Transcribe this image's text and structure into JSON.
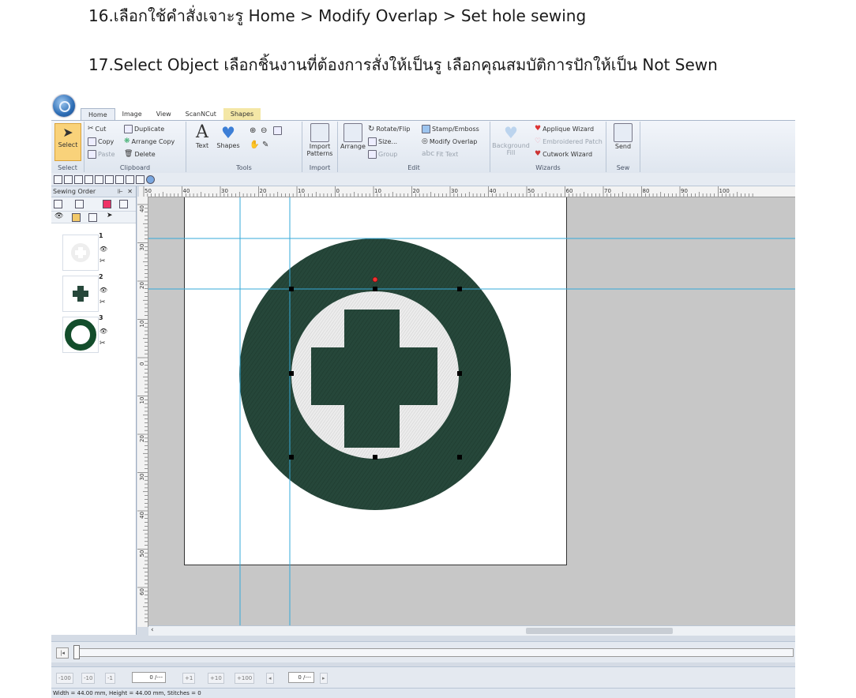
{
  "document": {
    "line16": "16.เลือกใช้คำสั่งเจาะรู  Home > Modify Overlap > Set hole sewing",
    "line17": "17.Select Object เลือกชิ้นงานที่ต้องการสั่งให้เป็นรู  เลือกคุณสมบัติการปักให้เป็น Not Sewn"
  },
  "tabs": [
    "Home",
    "Image",
    "View",
    "ScanNCut",
    "Shapes"
  ],
  "ribbon": {
    "select_group": {
      "select": "Select",
      "label": "Select"
    },
    "clipboard": {
      "cut": "Cut",
      "copy": "Copy",
      "paste": "Paste",
      "duplicate": "Duplicate",
      "arrange_copy": "Arrange Copy",
      "delete": "Delete",
      "label": "Clipboard"
    },
    "tools": {
      "text": "Text",
      "shapes": "Shapes",
      "label": "Tools"
    },
    "import": {
      "import_patterns": "Import Patterns",
      "label": "Import"
    },
    "edit": {
      "arrange": "Arrange",
      "rotate_flip": "Rotate/Flip",
      "size": "Size...",
      "group": "Group",
      "stamp_emboss": "Stamp/Emboss",
      "modify_overlap": "Modify Overlap",
      "fit_text": "Fit Text",
      "label": "Edit"
    },
    "wizards": {
      "background_fill": "Background Fill",
      "applique_wizard": "Applique Wizard",
      "embroidered_patch": "Embroidered Patch",
      "cutwork_wizard": "Cutwork Wizard",
      "label": "Wizards"
    },
    "sew": {
      "send": "Send",
      "label": "Sew"
    }
  },
  "sewing_order": {
    "title": "Sewing Order",
    "items": [
      {
        "num": "1",
        "desc": "white circle"
      },
      {
        "num": "2",
        "desc": "green cross"
      },
      {
        "num": "3",
        "desc": "green ring"
      }
    ]
  },
  "ruler": {
    "h_labels": [
      "50",
      "40",
      "30",
      "20",
      "10",
      "0",
      "10",
      "20",
      "30",
      "40",
      "50",
      "60",
      "70",
      "80",
      "90",
      "100"
    ],
    "v_labels": [
      "40",
      "30",
      "20",
      "10",
      "0",
      "10",
      "20",
      "30",
      "40",
      "50",
      "60"
    ]
  },
  "nav": {
    "b100m": "-100",
    "b10m": "-10",
    "b1m": "-1",
    "field1": "0 /---",
    "b1p": "+1",
    "b10p": "+10",
    "b100p": "+100",
    "field2": "0 /---"
  },
  "status": "Width = 44.00 mm, Height = 44.00 mm, Stitches = 0",
  "colors": {
    "embroidery_green": "#26473a",
    "inner_white": "#e4e4e4",
    "guide_blue": "#36a9d8"
  }
}
